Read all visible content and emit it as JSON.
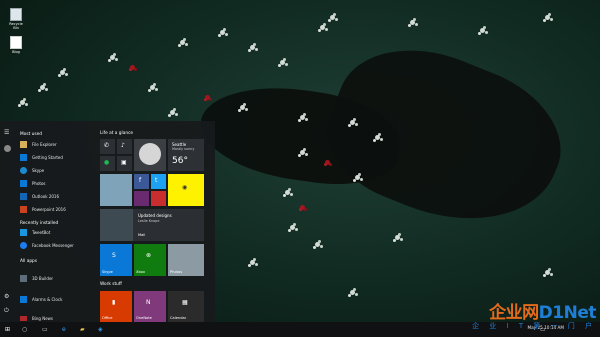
{
  "desktop": {
    "icons": [
      {
        "label": "Recycle Bin",
        "icon": "recycle-bin-icon"
      },
      {
        "label": "Blog",
        "icon": "document-icon"
      }
    ]
  },
  "start": {
    "most_used_header": "Most used",
    "most_used": [
      {
        "label": "File Explorer",
        "icon": "folder-icon",
        "color": "#d8b15b"
      },
      {
        "label": "Getting Started",
        "icon": "lightbulb-icon",
        "color": "#0a78d7"
      },
      {
        "label": "Skype",
        "icon": "skype-icon",
        "color": "#1a8ad1"
      },
      {
        "label": "Photos",
        "icon": "photos-icon",
        "color": "#0a78d7"
      },
      {
        "label": "Outlook 2016",
        "icon": "outlook-icon",
        "color": "#1266b5"
      },
      {
        "label": "Powerpoint 2016",
        "icon": "powerpoint-icon",
        "color": "#c9431f"
      }
    ],
    "recently_added_header": "Recently installed",
    "recently_added": [
      {
        "label": "TweetBot",
        "icon": "twitter-icon",
        "color": "#1b95e0"
      },
      {
        "label": "Facebook Messenger",
        "icon": "messenger-icon",
        "color": "#1b7df2"
      }
    ],
    "all_apps_header": "All apps",
    "all_apps": [
      {
        "label": "3D Builder",
        "icon": "3d-builder-icon",
        "color": "#5d6d7a"
      },
      {
        "label": "Alarms & Clock",
        "icon": "alarm-icon",
        "color": "#0a78d7"
      },
      {
        "label": "Bing News",
        "icon": "news-icon",
        "color": "#b0282c"
      }
    ],
    "tiles_header": "Life at a glance",
    "weather": {
      "city": "Seattle",
      "condition": "Mostly sunny",
      "temp": "56°"
    },
    "tiles": {
      "news_label": "Updated designs",
      "news_sub": "Leslie Knope",
      "mail_label": "Mail",
      "skype_label": "Skype",
      "xbox_label": "Xbox",
      "photos_label": "Photos",
      "store_label": "Store"
    },
    "work_header": "Work stuff",
    "work_tiles": [
      {
        "label": "Office",
        "color": "#d83b01"
      },
      {
        "label": "OneNote",
        "color": "#80397b"
      },
      {
        "label": "Calendar",
        "color": "#2b2b2b"
      }
    ]
  },
  "taskbar": {
    "clock": "May 25 10:14 AM"
  },
  "watermark": {
    "line1a": "企业网",
    "line1b": "D1Net",
    "line2": "企 业 I T 第 一 门 户"
  }
}
